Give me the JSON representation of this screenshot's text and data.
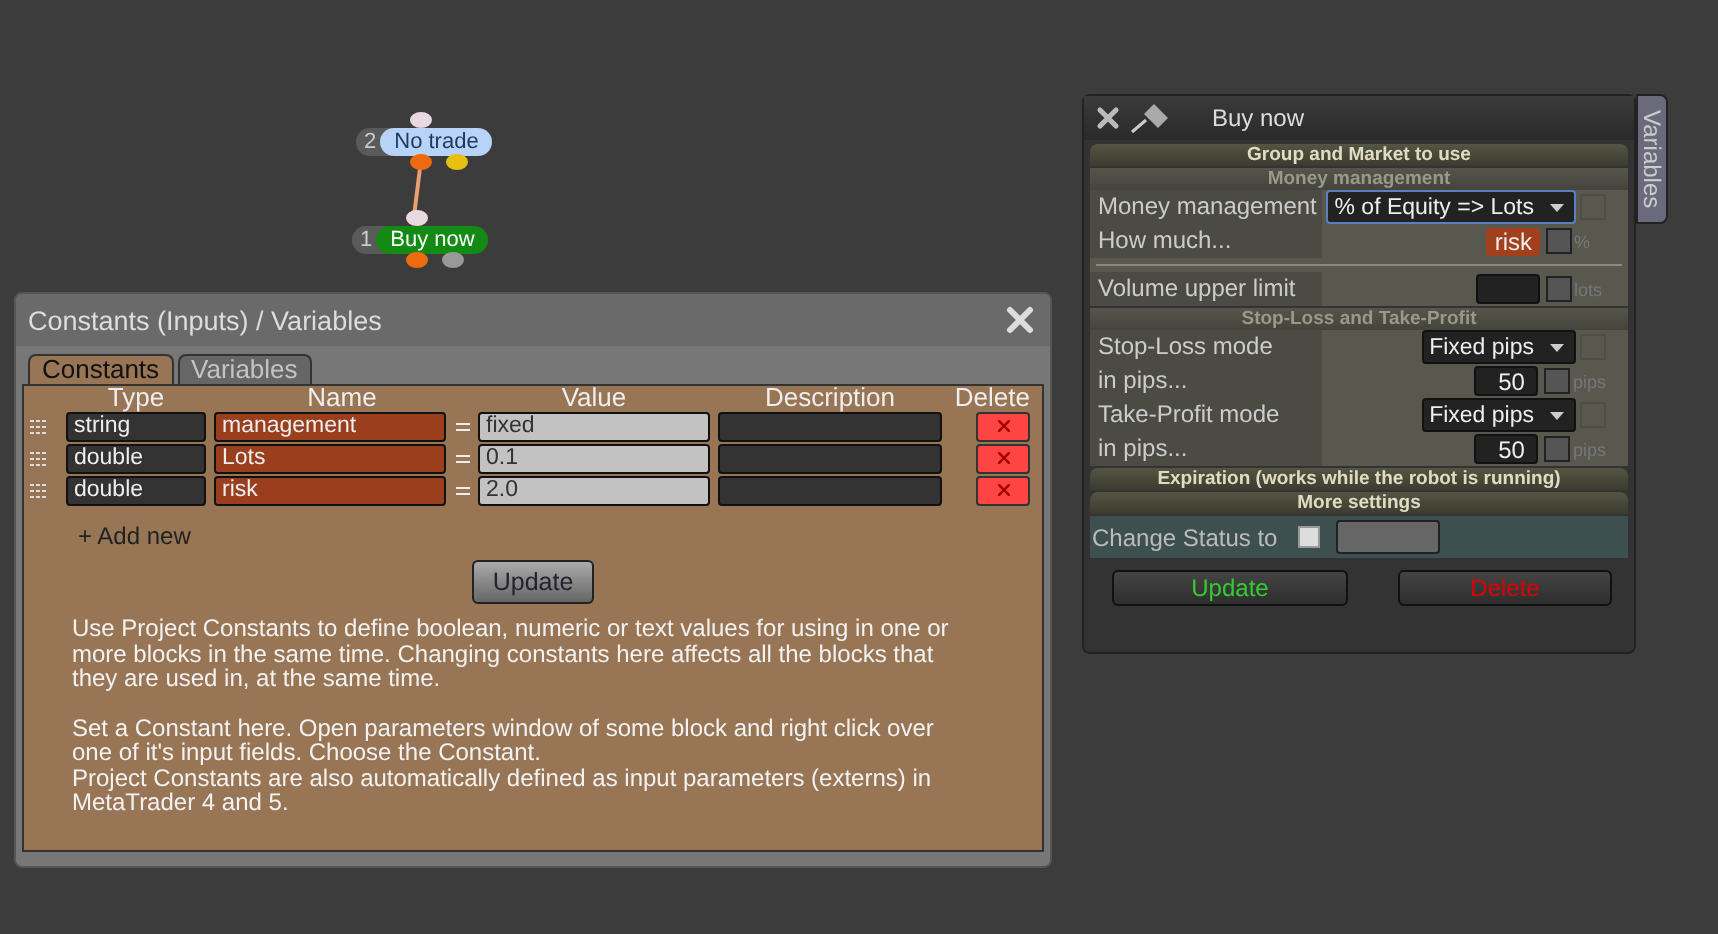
{
  "nodes": [
    {
      "number": "2",
      "label": "No trade",
      "color": "#b7d3f7"
    },
    {
      "number": "1",
      "label": "Buy now",
      "color": "#138a13"
    }
  ],
  "constants_window": {
    "title": "Constants (Inputs) / Variables",
    "tabs": [
      {
        "label": "Constants",
        "selected": true
      },
      {
        "label": "Variables",
        "selected": false
      }
    ],
    "columns": [
      "Type",
      "Name",
      "Value",
      "Description",
      "Delete"
    ],
    "rows": [
      {
        "type": "string",
        "name": "management",
        "value": "fixed"
      },
      {
        "type": "double",
        "name": "Lots",
        "value": "0.1"
      },
      {
        "type": "double",
        "name": "risk",
        "value": "2.0"
      }
    ],
    "add_new": "+ Add new",
    "update_button": "Update",
    "help_blocks": [
      [
        "Use Project Constants to define boolean, numeric or text values for using in one or more blocks in the same time. Changing constants here affects all the blocks that they are used in, at the same time."
      ],
      [
        "Set a Constant here. Open parameters window of some block and right click over one of it's input fields. Choose the Constant.",
        "Project Constants are also automatically defined as input parameters (externs) in MetaTrader 4 and 5."
      ]
    ]
  },
  "block_window": {
    "title": "Buy now",
    "side_tab": "Variables",
    "sections": [
      {
        "kind": "header",
        "label": "Group and Market to use"
      },
      {
        "kind": "group",
        "title": "Money management",
        "rows": [
          {
            "kind": "dropdown",
            "label": "Money management",
            "value": "% of Equity => Lots",
            "checked": false
          },
          {
            "kind": "number",
            "label": "How much...",
            "constant": "risk",
            "unit": "%",
            "checked": false
          },
          {
            "kind": "divider"
          },
          {
            "kind": "number",
            "label": "Volume upper limit",
            "unit": "lots",
            "checked": false
          }
        ]
      },
      {
        "kind": "group",
        "title": "Stop-Loss and Take-Profit",
        "rows": [
          {
            "kind": "dropdown",
            "label": "Stop-Loss mode",
            "value": "Fixed pips",
            "checked": false
          },
          {
            "kind": "number",
            "label": "in pips...",
            "value": "50",
            "unit": "pips",
            "checked": false
          },
          {
            "kind": "dropdown",
            "label": "Take-Profit mode",
            "value": "Fixed pips",
            "checked": false
          },
          {
            "kind": "number",
            "label": "in pips...",
            "value": "50",
            "unit": "pips",
            "checked": false
          }
        ]
      },
      {
        "kind": "header",
        "label": "Expiration (works while the robot is running)"
      },
      {
        "kind": "header",
        "label": "More settings"
      }
    ],
    "status": {
      "label": "Change Status to",
      "checked": false
    },
    "buttons": [
      {
        "label": "Update",
        "kind": "confirm"
      },
      {
        "label": "Delete",
        "kind": "danger"
      }
    ]
  }
}
